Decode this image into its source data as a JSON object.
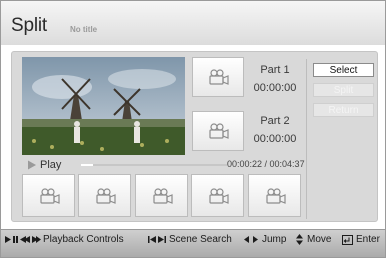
{
  "header": {
    "title": "Split",
    "subtitle": "No title"
  },
  "parts": [
    {
      "label": "Part 1",
      "time": "00:00:00"
    },
    {
      "label": "Part 2",
      "time": "00:00:00"
    }
  ],
  "buttons": {
    "select": "Select",
    "split": "Split",
    "return": "Return"
  },
  "playback": {
    "play_label": "Play",
    "elapsed": "00:00:22",
    "total": "00:04:37",
    "time_display": "00:00:22 / 00:04:37",
    "progress_fraction": 0.079
  },
  "footer": {
    "playback_controls": "Playback Controls",
    "scene_search": "Scene Search",
    "jump": "Jump",
    "move": "Move",
    "enter": "Enter"
  },
  "icons": {
    "thumbnail": "film-camera-icon",
    "play": "play-icon",
    "playback_controls": "playback-controls-icon",
    "scene_search": "skip-icon",
    "jump": "left-right-arrows-icon",
    "move": "up-down-arrows-icon",
    "enter": "enter-icon"
  },
  "colors": {
    "panel": "#d9d9d9",
    "title_bar": "#e8e8e8",
    "bottom_bar": "#bdbdbd"
  }
}
